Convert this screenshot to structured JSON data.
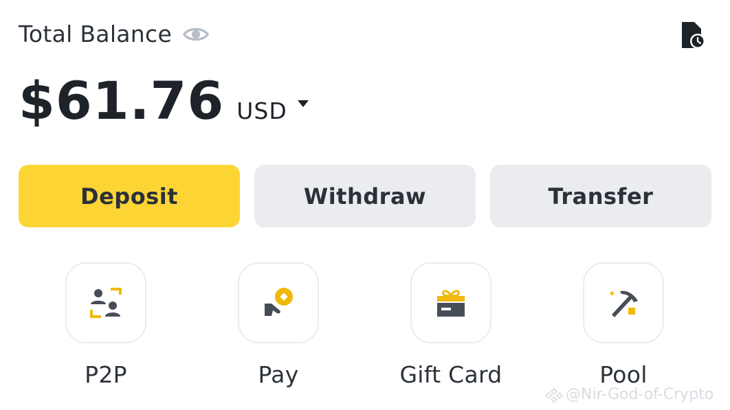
{
  "balance": {
    "label": "Total Balance",
    "amount": "$61.76",
    "currency": "USD"
  },
  "actions": {
    "deposit": "Deposit",
    "withdraw": "Withdraw",
    "transfer": "Transfer"
  },
  "shortcuts": [
    {
      "label": "P2P",
      "icon": "p2p-icon"
    },
    {
      "label": "Pay",
      "icon": "pay-icon"
    },
    {
      "label": "Gift Card",
      "icon": "gift-card-icon"
    },
    {
      "label": "Pool",
      "icon": "pool-icon"
    }
  ],
  "watermark": "@Nir-God-of-Crypto",
  "colors": {
    "accent": "#fcd535",
    "text": "#1e2329",
    "secondary_button": "#eaecef",
    "icon_dark": "#474d57"
  }
}
